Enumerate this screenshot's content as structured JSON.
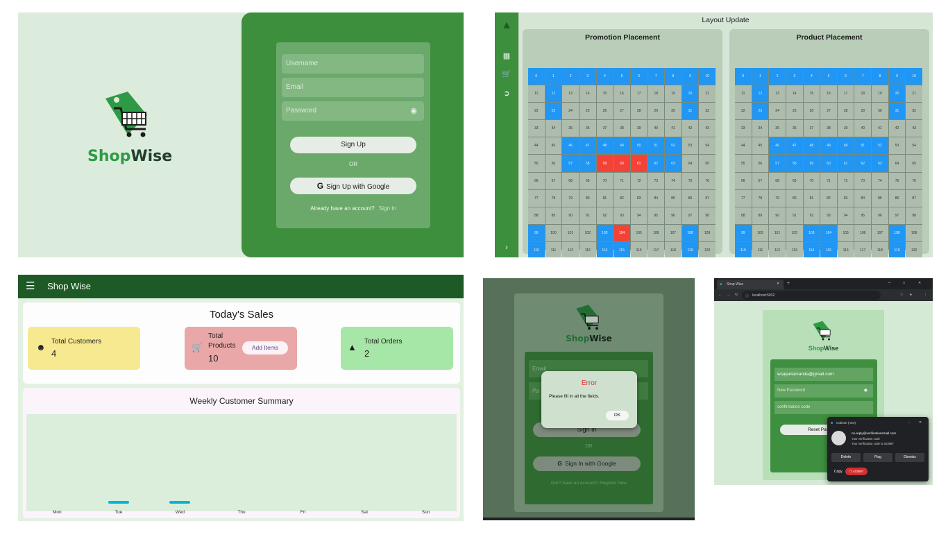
{
  "signup": {
    "brand_a": "Shop",
    "brand_b": "Wise",
    "username_placeholder": "Username",
    "email_placeholder": "Email",
    "password_placeholder": "Password",
    "signup_label": "Sign Up",
    "or_label": "OR",
    "google_label": "Sign Up with Google",
    "have_account": "Already have an account?",
    "signin_link": "Sign In"
  },
  "layout": {
    "title": "Layout Update",
    "promo_title": "Promotion Placement",
    "product_title": "Product Placement",
    "promo_blue": [
      0,
      1,
      2,
      3,
      4,
      5,
      6,
      7,
      8,
      9,
      10,
      12,
      20,
      23,
      31,
      46,
      47,
      48,
      49,
      50,
      51,
      52,
      57,
      58,
      62,
      63,
      99,
      103,
      108,
      110,
      114,
      115,
      119
    ],
    "promo_red": [
      59,
      60,
      61,
      104
    ],
    "product_blue": [
      0,
      1,
      2,
      3,
      4,
      5,
      6,
      7,
      8,
      9,
      10,
      12,
      20,
      23,
      31,
      46,
      47,
      48,
      49,
      50,
      51,
      52,
      57,
      58,
      59,
      60,
      61,
      62,
      63,
      99,
      103,
      104,
      108,
      110,
      114,
      115,
      119
    ],
    "product_red": []
  },
  "dashboard": {
    "app_title": "Shop Wise",
    "sales_title": "Today's Sales",
    "customers_label": "Total Customers",
    "customers_value": "4",
    "products_label_1": "Total",
    "products_label_2": "Products",
    "products_value": "10",
    "add_items": "Add Items",
    "orders_label": "Total Orders",
    "orders_value": "2",
    "weekly_title": "Weekly Customer Summary",
    "days": [
      "Mon",
      "Tue",
      "Wed",
      "Thu",
      "Fri",
      "Sat",
      "Sun"
    ],
    "chart_values": [
      0,
      1,
      1,
      0,
      0,
      0,
      0
    ]
  },
  "signin_error": {
    "brand_a": "Shop",
    "brand_b": "Wise",
    "email_placeholder": "Email",
    "password_placeholder": "Pa",
    "error_title": "Error",
    "error_message": "Please fill in all the fields.",
    "ok_label": "OK",
    "signin_label": "Sign In",
    "or_label": "OR",
    "google_label": "Sign In with Google",
    "no_account": "Don't have an account?",
    "register_link": "Register Now"
  },
  "reset": {
    "tab_title": "Shop Wise",
    "url": "localhost:5032",
    "brand_a": "Shop",
    "brand_b": "Wise",
    "email_value": "wsajaniamanda@gmail.com",
    "new_password_placeholder": "New Password",
    "code_placeholder": "confirmation code",
    "reset_label": "Reset Pas",
    "notif_app": "Outlook (new)",
    "notif_from": "no-reply@verificationemail.com",
    "notif_line1": "Your verification code",
    "notif_line2": "Your verification code is 403697",
    "delete_label": "Delete",
    "flag_label": "Flag",
    "dismiss_label": "Dismiss",
    "copy_label": "Copy",
    "copy_code": "403697"
  }
}
